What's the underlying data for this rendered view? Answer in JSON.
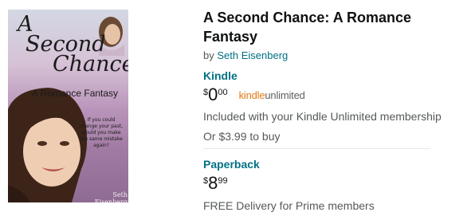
{
  "cover": {
    "title_lines": [
      "A",
      "Second",
      "Chance"
    ],
    "subtitle": "A Romance Fantasy",
    "blurb": "If you could change your past, would you make the same mistake again?",
    "author": "Seth Eisenberg"
  },
  "book": {
    "title": "A Second Chance: A Romance Fantasy",
    "by_prefix": "by",
    "author": "Seth Eisenberg"
  },
  "formats": [
    {
      "name": "Kindle",
      "price": {
        "symbol": "$",
        "whole": "0",
        "fraction": "00"
      },
      "badge": {
        "kindle": "kindle",
        "unlimited": "unlimited"
      },
      "note": "Included with your Kindle Unlimited membership",
      "alt_price": "Or $3.99 to buy"
    },
    {
      "name": "Paperback",
      "price": {
        "symbol": "$",
        "whole": "8",
        "fraction": "99"
      },
      "note": "FREE Delivery for Prime members"
    }
  ],
  "colors": {
    "link": "#007185",
    "text": "#0f1111",
    "muted": "#565959",
    "kindle_orange": "#e47911"
  }
}
